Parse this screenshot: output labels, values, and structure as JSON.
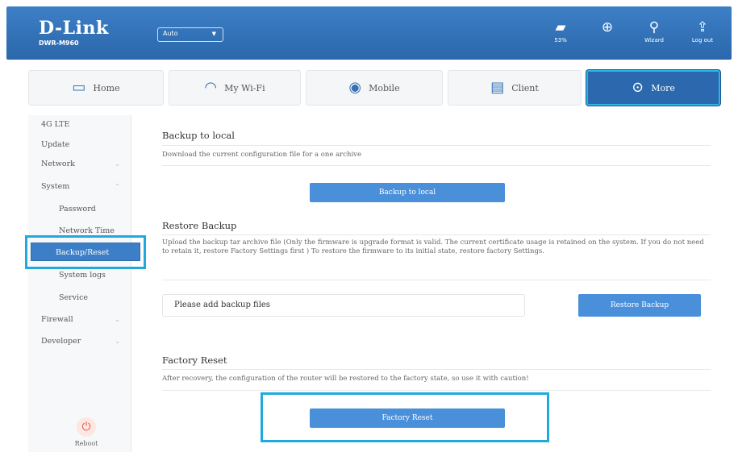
{
  "header": {
    "brand": "D-Link",
    "model": "DWR-M960",
    "language": "Auto",
    "icons": [
      {
        "name": "battery-icon",
        "glyph": "▰",
        "label": "53%"
      },
      {
        "name": "globe-icon",
        "glyph": "⊕",
        "label": ""
      },
      {
        "name": "wizard-icon",
        "glyph": "⚲",
        "label": "Wizard"
      },
      {
        "name": "logout-icon",
        "glyph": "⇪",
        "label": "Log out"
      }
    ]
  },
  "tabs": [
    {
      "name": "home",
      "icon": "▭",
      "label": "Home"
    },
    {
      "name": "my-wifi",
      "icon": "◠",
      "label": "My Wi-Fi"
    },
    {
      "name": "mobile",
      "icon": "◉",
      "label": "Mobile"
    },
    {
      "name": "client",
      "icon": "▤",
      "label": "Client"
    },
    {
      "name": "more",
      "icon": "⊙",
      "label": "More"
    }
  ],
  "sidebar": {
    "items": [
      {
        "label": "4G LTE",
        "sub": false,
        "chevron": false
      },
      {
        "label": "Update",
        "sub": false,
        "chevron": false
      },
      {
        "label": "Network",
        "sub": false,
        "chevron": true
      },
      {
        "label": "System",
        "sub": false,
        "chevron": true
      },
      {
        "label": "Password",
        "sub": true,
        "chevron": false
      },
      {
        "label": "Network Time",
        "sub": true,
        "chevron": false
      },
      {
        "label": "Backup/Reset",
        "sub": true,
        "chevron": false,
        "selected": true
      },
      {
        "label": "System logs",
        "sub": true,
        "chevron": false
      },
      {
        "label": "Service",
        "sub": true,
        "chevron": false
      },
      {
        "label": "Firewall",
        "sub": false,
        "chevron": true
      },
      {
        "label": "Developer",
        "sub": false,
        "chevron": true
      }
    ],
    "reboot_label": "Reboot"
  },
  "backup": {
    "title": "Backup to local",
    "description": "Download the current configuration file for a one archive",
    "button": "Backup to local"
  },
  "restore": {
    "title": "Restore Backup",
    "description": "Upload the backup tar archive file (Only the firmware is upgrade format is valid. The current certificate usage is retained on the system. If you do not need to retain it, restore Factory Settings first ) To restore the firmware to its initial state, restore factory Settings.",
    "placeholder": "Please add backup files",
    "button": "Restore Backup"
  },
  "factory": {
    "title": "Factory Reset",
    "description": "After recovery, the configuration of the router will be restored to the factory state, so use it with caution!",
    "button": "Factory Reset"
  }
}
